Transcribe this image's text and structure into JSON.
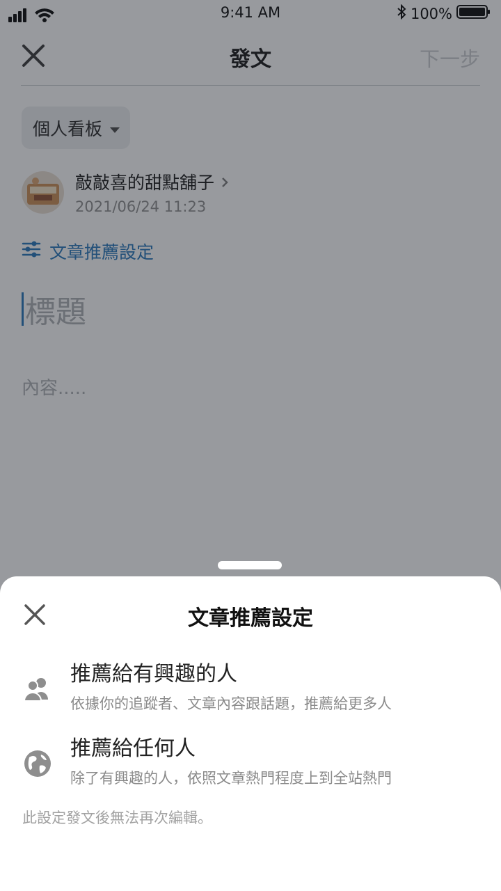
{
  "status_bar": {
    "time": "9:41 AM",
    "battery": "100%"
  },
  "nav": {
    "title": "發文",
    "next_label": "下一步"
  },
  "board_selector": {
    "label": "個人看板"
  },
  "author": {
    "name": "敲敲喜的甜點舖子",
    "date": "2021/06/24 11:23"
  },
  "recommend_link": {
    "label": "文章推薦設定"
  },
  "post": {
    "title_placeholder": "標題",
    "content_placeholder": "內容....."
  },
  "sheet": {
    "title": "文章推薦設定",
    "options": [
      {
        "label": "推薦給有興趣的人",
        "desc": "依據你的追蹤者、文章內容跟話題，推薦給更多人",
        "icon": "people-icon"
      },
      {
        "label": "推薦給任何人",
        "desc": "除了有興趣的人，依照文章熱門程度上到全站熱門",
        "icon": "globe-icon"
      }
    ],
    "note": "此設定發文後無法再次編輯。"
  },
  "colors": {
    "accent": "#1f72b8",
    "overlay": "#96999e",
    "sheet_bg": "#ffffff"
  }
}
